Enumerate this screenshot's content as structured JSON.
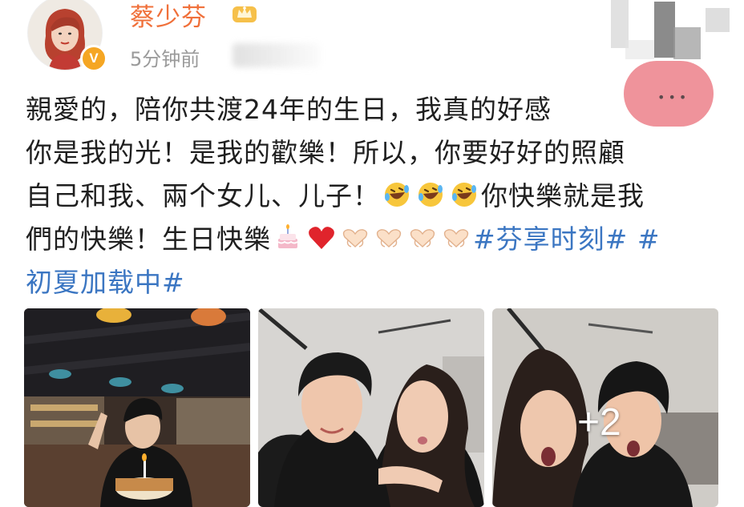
{
  "post": {
    "author": {
      "name": "蔡少芬",
      "badge_icon": "crown-icon",
      "verified_icon": "verified-badge-icon",
      "verified_symbol": "V"
    },
    "timestamp": "5分钟前",
    "more_icon": "more-dots-icon",
    "more_symbol": "•••",
    "text_lines": {
      "line1": "親愛的，陪你共渡24年的生日，我真的好感",
      "line2": "你是我的光！是我的歡樂！所以，你要好好的照顧",
      "line3_a": "自己和我、兩个女儿、儿子！",
      "line3_b": "你快樂就是我",
      "line4_a": "們的快樂！生日快樂",
      "line4_hashtag1": "#芬享时刻#",
      "line4_hashtag2_part": "#",
      "line5_hashtag2_rest": "初夏加载中#"
    },
    "emojis": {
      "laughing": "rofl-icon",
      "cake": "birthday-cake-icon",
      "heart": "red-heart-icon",
      "heart_hands": "heart-hands-icon"
    },
    "photos": {
      "count_overlay": "+2",
      "items": [
        "photo-birthday-cake",
        "photo-couple-selfie",
        "photo-couple-surprised"
      ]
    }
  },
  "colors": {
    "username": "#f0703a",
    "hashtag": "#3b76c2",
    "text": "#1f1f1f",
    "timestamp": "#9a9a9a",
    "verified": "#f5a623",
    "menu": "#ee8a92"
  }
}
